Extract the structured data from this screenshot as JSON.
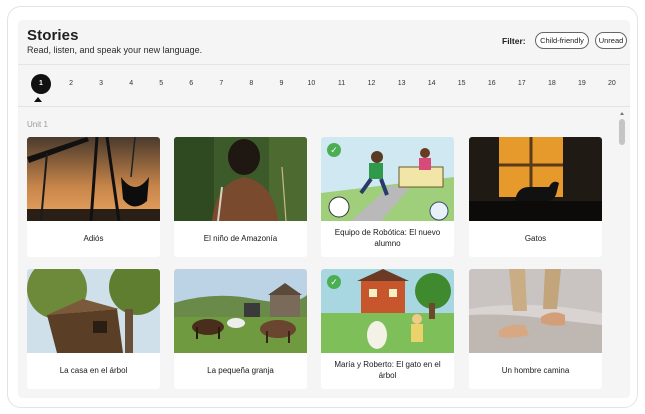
{
  "header": {
    "title": "Stories",
    "subtitle": "Read, listen, and speak your new language.",
    "filter_label": "Filter:",
    "filters": [
      "Child-friendly",
      "Unread"
    ]
  },
  "pagination": {
    "pages": [
      "1",
      "2",
      "3",
      "4",
      "5",
      "6",
      "7",
      "8",
      "9",
      "10",
      "11",
      "12",
      "13",
      "14",
      "15",
      "16",
      "17",
      "18",
      "19",
      "20"
    ],
    "active": "1"
  },
  "unit_label": "Unit 1",
  "stories": [
    {
      "title": "Adiós",
      "completed": false
    },
    {
      "title": "El niño de Amazonía",
      "completed": false
    },
    {
      "title": "Equipo de Robótica: El nuevo alumno",
      "completed": true
    },
    {
      "title": "Gatos",
      "completed": false
    },
    {
      "title": "La casa en el árbol",
      "completed": false
    },
    {
      "title": "La pequeña granja",
      "completed": false
    },
    {
      "title": "María y Roberto: El gato en el árbol",
      "completed": true
    },
    {
      "title": "Un hombre camina",
      "completed": false
    }
  ],
  "colors": {
    "completed_badge": "#4cae52",
    "active_page": "#111111",
    "panel_bg": "#f5f5f5"
  },
  "icons": {
    "completed": "checkmark-icon",
    "active_page": "caret-up-icon"
  }
}
